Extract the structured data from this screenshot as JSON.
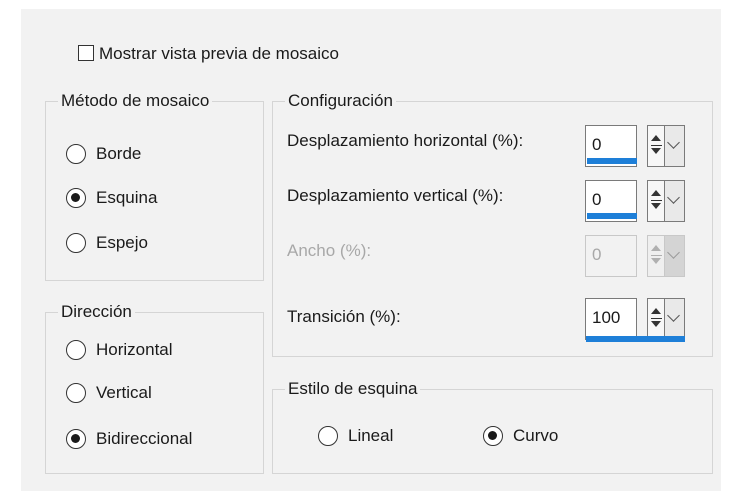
{
  "preview_label": "Mostrar vista previa de mosaico",
  "method": {
    "title": "Método de mosaico",
    "options": [
      "Borde",
      "Esquina",
      "Espejo"
    ],
    "selected": "Esquina"
  },
  "direction": {
    "title": "Dirección",
    "options": [
      "Horizontal",
      "Vertical",
      "Bidireccional"
    ],
    "selected": "Bidireccional"
  },
  "config": {
    "title": "Configuración",
    "fields": [
      {
        "label": "Desplazamiento horizontal (%):",
        "value": "0",
        "enabled": true,
        "level": 0
      },
      {
        "label": "Desplazamiento vertical (%):",
        "value": "0",
        "enabled": true,
        "level": 0
      },
      {
        "label": "Ancho (%):",
        "value": "0",
        "enabled": false,
        "level": 0
      },
      {
        "label": "Transición (%):",
        "value": "100",
        "enabled": true,
        "level": 1
      }
    ]
  },
  "corner_style": {
    "title": "Estilo de esquina",
    "options": [
      "Lineal",
      "Curvo"
    ],
    "selected": "Curvo"
  },
  "colors": {
    "accent": "#1e7fd8",
    "panel": "#f2f2f2"
  }
}
